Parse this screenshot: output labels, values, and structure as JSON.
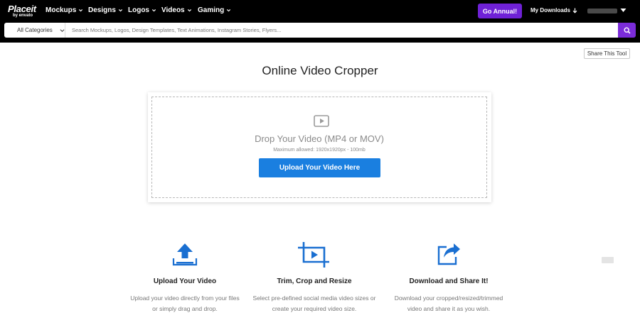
{
  "nav": {
    "logo": {
      "main": "Placeit",
      "sub": "by envato"
    },
    "items": [
      {
        "label": "Mockups"
      },
      {
        "label": "Designs"
      },
      {
        "label": "Logos"
      },
      {
        "label": "Videos"
      },
      {
        "label": "Gaming"
      }
    ],
    "go_annual": "Go Annual!",
    "my_downloads": "My Downloads",
    "user_name": ""
  },
  "search": {
    "category": "All Categories",
    "placeholder": "Search Mockups, Logos, Design Templates, Text Animations, Instagram Stories, Flyers..."
  },
  "share_label": "Share This Tool",
  "page_title": "Online Video Cropper",
  "drop": {
    "title": "Drop Your Video (MP4 or MOV)",
    "subtitle": "Maximum allowed: 1920x1920px - 100mb",
    "button": "Upload Your Video Here"
  },
  "features": [
    {
      "icon": "upload-icon",
      "title": "Upload Your Video",
      "line1": "Upload your video directly from your files",
      "line2": "or simply drag and drop."
    },
    {
      "icon": "crop-icon",
      "title": "Trim, Crop and Resize",
      "line1": "Select pre-defined social media video sizes or",
      "line2": "create your required video size."
    },
    {
      "icon": "share-icon",
      "title": "Download and Share It!",
      "line1": "Download your cropped/resized/trimmed",
      "line2": "video and share it as you wish."
    }
  ],
  "colors": {
    "accent_purple": "#6f21d6",
    "upload_blue": "#1a7fe0",
    "icon_blue": "#1a6fd1"
  }
}
